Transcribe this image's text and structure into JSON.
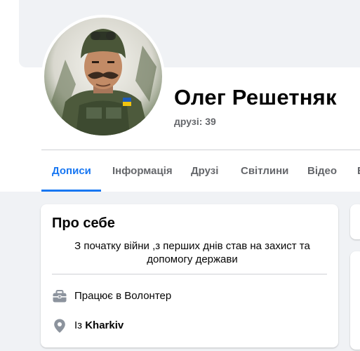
{
  "profile": {
    "name": "Олег Решетняк",
    "friends_count": "друзі: 39"
  },
  "tabs": [
    {
      "label": "Дописи",
      "active": true
    },
    {
      "label": "Інформація",
      "active": false
    },
    {
      "label": "Друзі",
      "active": false
    },
    {
      "label": "Світлини",
      "active": false
    },
    {
      "label": "Відео",
      "active": false
    },
    {
      "label": "Е",
      "active": false
    }
  ],
  "about": {
    "title": "Про себе",
    "bio": "З початку війни ,з перших днів став на захист та допомогу держави",
    "work_prefix": "Працює в",
    "work_value": "Волонтер",
    "from_prefix": "Із",
    "from_value": "Kharkiv"
  },
  "icons": {
    "work": "briefcase-icon",
    "location": "map-pin-icon"
  },
  "colors": {
    "accent": "#1877f2",
    "secondary_text": "#65676b",
    "background": "#f0f2f5"
  }
}
